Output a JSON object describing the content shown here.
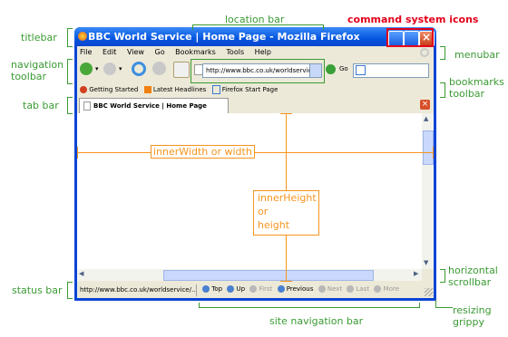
{
  "diagram": {
    "window_title": "BBC World Service | Home Page - Mozilla Firefox",
    "menu_items": [
      "File",
      "Edit",
      "View",
      "Go",
      "Bookmarks",
      "Tools",
      "Help"
    ],
    "url": "http://www.bbc.co.uk/worldservic",
    "go_label": "Go",
    "bookmarks": [
      "Getting Started",
      "Latest Headlines",
      "Firefox Start Page"
    ],
    "tab_title": "BBC World Service | Home Page",
    "status_url": "http://www.bbc.co.uk/worldservice/...",
    "site_nav": [
      "Top",
      "Up",
      "First",
      "Previous",
      "Next",
      "Last",
      "More"
    ],
    "content_labels": {
      "width_label": "innerWidth or width",
      "height_line1": "innerHeight",
      "height_line2": "or",
      "height_line3": "height"
    }
  },
  "callouts": {
    "titlebar": "titlebar",
    "navigation_toolbar_1": "navigation",
    "navigation_toolbar_2": "toolbar",
    "tab_bar": "tab bar",
    "status_bar": "status bar",
    "location_bar": "location bar",
    "command_system_icons": "command system icons",
    "menubar": "menubar",
    "bookmarks_toolbar_1": "bookmarks",
    "bookmarks_toolbar_2": "toolbar",
    "horizontal_scrollbar_1": "horizontal",
    "horizontal_scrollbar_2": "scrollbar",
    "site_navigation_bar": "site navigation bar",
    "resizing_grippy_1": "resizing",
    "resizing_grippy_2": "grippy"
  },
  "colors": {
    "callout_green": "#3a9a33",
    "callout_red": "#e3001b",
    "dimension_orange": "#f7941d",
    "titlebar_blue": "#0556e0"
  }
}
